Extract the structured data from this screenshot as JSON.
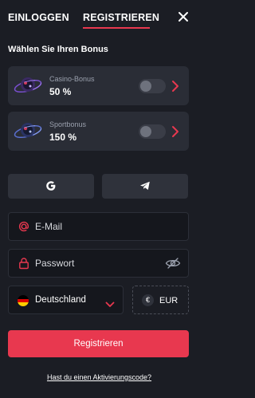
{
  "header": {
    "tabs": [
      {
        "label": "EINLOGGEN",
        "active": false
      },
      {
        "label": "REGISTRIEREN",
        "active": true
      }
    ],
    "close_icon": "close-icon"
  },
  "bonus": {
    "title": "Wählen Sie Ihren Bonus",
    "options": [
      {
        "label": "Casino-Bonus",
        "value": "50 %",
        "enabled": false,
        "icon": "casino-bonus-icon"
      },
      {
        "label": "Sportbonus",
        "value": "150 %",
        "enabled": false,
        "icon": "sport-bonus-icon"
      }
    ]
  },
  "social": [
    {
      "icon": "google-icon"
    },
    {
      "icon": "telegram-icon"
    }
  ],
  "form": {
    "email_placeholder": "E-Mail",
    "password_placeholder": "Passwort",
    "country": "Deutschland",
    "currency": "EUR",
    "currency_symbol": "€",
    "submit_label": "Registrieren",
    "activation_link": "Hast du einen Aktivierungscode?"
  },
  "colors": {
    "accent": "#e8384f",
    "background": "#1b1d24",
    "card": "#2a2d36"
  }
}
